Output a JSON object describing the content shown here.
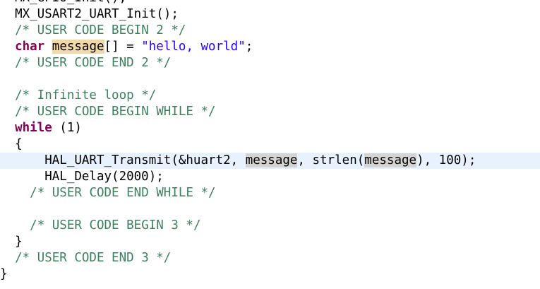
{
  "editor": {
    "lines": [
      {
        "indent": "  ",
        "parts": [
          {
            "text": "MX_GPIO_Init();",
            "kind": "plain"
          }
        ]
      },
      {
        "indent": "  ",
        "parts": [
          {
            "text": "MX_USART2_UART_Init();",
            "kind": "plain"
          }
        ]
      },
      {
        "indent": "  ",
        "parts": [
          {
            "text": "/* USER CODE BEGIN 2 */",
            "kind": "comment"
          }
        ]
      },
      {
        "indent": "  ",
        "parts": [
          {
            "text": "char",
            "kind": "keyword"
          },
          {
            "text": " ",
            "kind": "plain"
          },
          {
            "text": "message",
            "kind": "occurrence-declaration"
          },
          {
            "text": "[] = ",
            "kind": "plain"
          },
          {
            "text": "\"hello, world\"",
            "kind": "string"
          },
          {
            "text": ";",
            "kind": "plain"
          }
        ]
      },
      {
        "indent": "  ",
        "parts": [
          {
            "text": "/* USER CODE END 2 */",
            "kind": "comment"
          }
        ]
      },
      {
        "indent": "",
        "parts": []
      },
      {
        "indent": "  ",
        "parts": [
          {
            "text": "/* Infinite loop */",
            "kind": "comment"
          }
        ]
      },
      {
        "indent": "  ",
        "parts": [
          {
            "text": "/* USER CODE BEGIN WHILE */",
            "kind": "comment"
          }
        ]
      },
      {
        "indent": "  ",
        "parts": [
          {
            "text": "while",
            "kind": "keyword"
          },
          {
            "text": " (1)",
            "kind": "plain"
          }
        ]
      },
      {
        "indent": "  ",
        "parts": [
          {
            "text": "{",
            "kind": "plain"
          }
        ]
      },
      {
        "indent": "      ",
        "current": true,
        "parts": [
          {
            "text": "HAL_UART_Transmit(&huart2, ",
            "kind": "plain"
          },
          {
            "text": "message",
            "kind": "occurrence"
          },
          {
            "text": ", strlen(",
            "kind": "plain"
          },
          {
            "text": "message",
            "kind": "occurrence"
          },
          {
            "text": "), 100);",
            "kind": "plain"
          }
        ]
      },
      {
        "indent": "      ",
        "parts": [
          {
            "text": "HAL_Delay(2000);",
            "kind": "plain"
          }
        ]
      },
      {
        "indent": "    ",
        "parts": [
          {
            "text": "/* USER CODE END WHILE */",
            "kind": "comment"
          }
        ]
      },
      {
        "indent": "",
        "parts": []
      },
      {
        "indent": "    ",
        "parts": [
          {
            "text": "/* USER CODE BEGIN 3 */",
            "kind": "comment"
          }
        ]
      },
      {
        "indent": "  ",
        "parts": [
          {
            "text": "}",
            "kind": "plain"
          }
        ]
      },
      {
        "indent": "  ",
        "parts": [
          {
            "text": "/* USER CODE END 3 */",
            "kind": "comment"
          }
        ]
      },
      {
        "indent": "",
        "parts": [
          {
            "text": "}",
            "kind": "plain"
          }
        ]
      }
    ],
    "colors": {
      "keyword": "#7f0055",
      "string": "#2a00ff",
      "comment": "#3f7f5f",
      "occurrence_highlight": "#d4d4d4",
      "declaration_highlight": "#f0d8a8",
      "current_line": "#e8f2fe"
    }
  }
}
